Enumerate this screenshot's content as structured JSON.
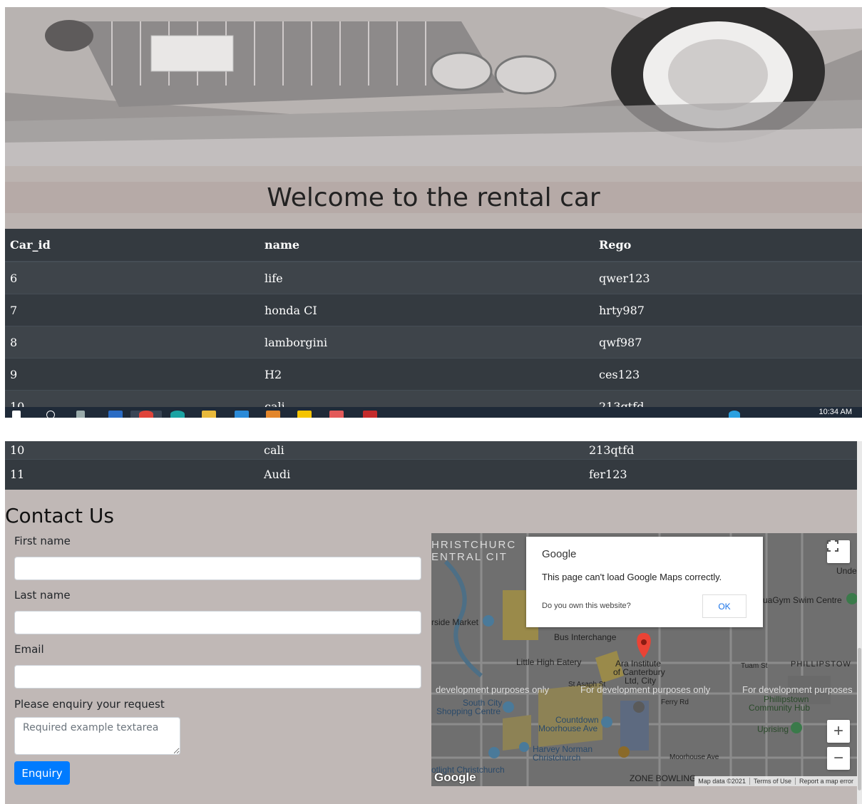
{
  "header": {
    "welcome": "Welcome to the rental car"
  },
  "cars_table": {
    "columns": [
      "Car_id",
      "name",
      "Rego"
    ],
    "rows": [
      {
        "id": "6",
        "name": "life",
        "rego": "qwer123"
      },
      {
        "id": "7",
        "name": "honda CI",
        "rego": "hrty987"
      },
      {
        "id": "8",
        "name": "lamborgini",
        "rego": "qwf987"
      },
      {
        "id": "9",
        "name": "H2",
        "rego": "ces123"
      },
      {
        "id": "10",
        "name": "cali",
        "rego": "213qtfd"
      },
      {
        "id": "11",
        "name": "Audi",
        "rego": "fer123"
      }
    ]
  },
  "taskbar": {
    "clock": "10:34 AM"
  },
  "contact": {
    "title": "Contact Us",
    "first_name_label": "First name",
    "last_name_label": "Last name",
    "email_label": "Email",
    "request_label": "Please enquiry your request",
    "textarea_placeholder": "Required example textarea",
    "submit_label": "Enquiry"
  },
  "map": {
    "dialog": {
      "brand": "Google",
      "message": "This page can't load Google Maps correctly.",
      "own_question": "Do you own this website?",
      "ok_label": "OK"
    },
    "dev_watermark": [
      "development purposes only",
      "For development purposes only",
      "For development purposes"
    ],
    "labels": {
      "christchurch": "HRISTCHURC",
      "central_city": "ENTRAL CIT",
      "under": "Under",
      "aquagym": "uaGym Swim Centre",
      "riverside": "rside Market",
      "bus": "Bus Interchange",
      "little_high": "Little High Eatery",
      "ara1": "Ara Institute",
      "ara2": "of Canterbury",
      "ara3": "Ltd, City",
      "st_asaph": "St Asaph St",
      "south_city1": "South City",
      "south_city2": "Shopping Centre",
      "countdown1": "Countdown",
      "countdown2": "Moorhouse Ave",
      "harvey1": "Harvey Norman",
      "harvey2": "Christchurch",
      "lighting": "otlight Christchurch",
      "zone": "ZONE BOWLING",
      "phillipstown": "PHILLIPSTOW",
      "phillip_hub1": "Phillipstown",
      "phillip_hub2": "Community Hub",
      "uprising": "Uprising",
      "moorhouse": "Moorhouse Ave",
      "ferry": "Ferry Rd",
      "tuam": "Tuam St"
    },
    "attribution": [
      "Map data ©2021",
      "Terms of Use",
      "Report a map error"
    ],
    "logo": "Google",
    "zoom_in": "+",
    "zoom_out": "−"
  }
}
